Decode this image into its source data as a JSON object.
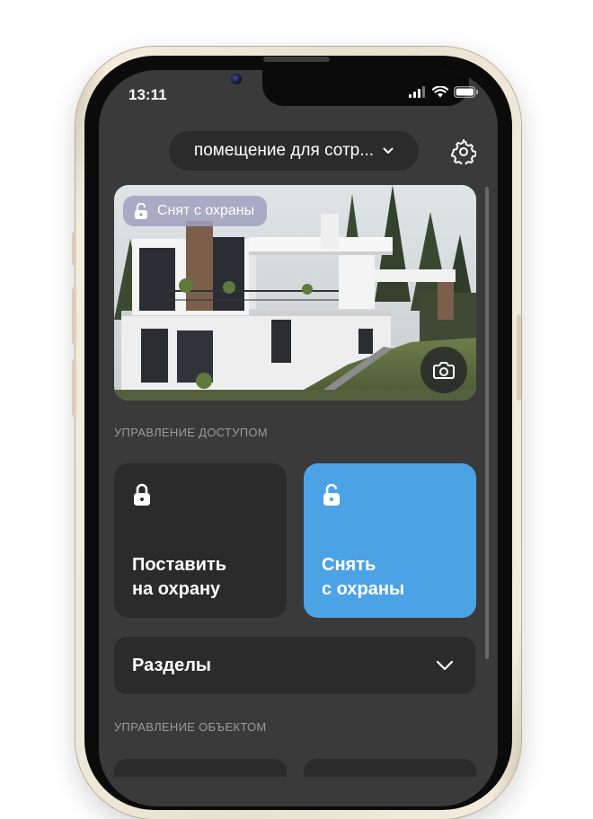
{
  "status_bar": {
    "time": "13:11"
  },
  "header": {
    "location_label": "помещение для сотр..."
  },
  "hero": {
    "status_badge": "Снят с охраны"
  },
  "access_section": {
    "title": "УПРАВЛЕНИЕ ДОСТУПОМ"
  },
  "arm_card": {
    "line1": "Поставить",
    "line2": "на охрану"
  },
  "disarm_card": {
    "line1": "Снять",
    "line2": "с охраны"
  },
  "sections_row": {
    "label": "Разделы"
  },
  "object_section": {
    "title": "УПРАВЛЕНИЕ ОБЪЕКТОМ"
  },
  "colors": {
    "accent": "#4ba3e6",
    "background": "#3a3a3a",
    "card": "#2b2b2b"
  },
  "icons": [
    "lock-closed-icon",
    "lock-open-icon",
    "gear-icon",
    "camera-icon",
    "chevron-down-icon"
  ]
}
